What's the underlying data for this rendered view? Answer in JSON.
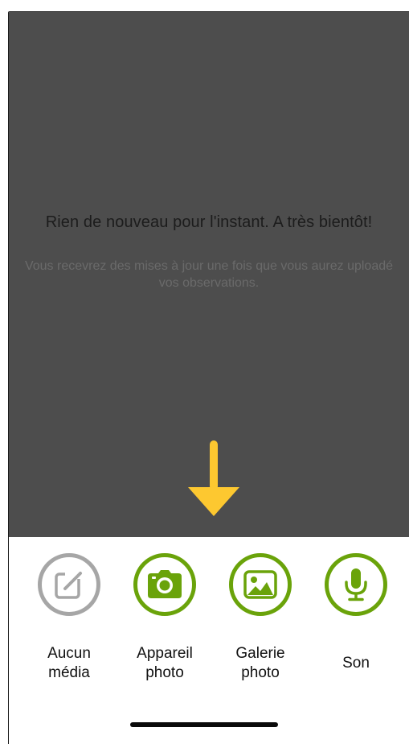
{
  "empty_state": {
    "title": "Rien de nouveau pour l'instant. A très bientôt!",
    "subtitle": "Vous recevrez des mises à jour une fois que vous aurez uploadé vos observations."
  },
  "media_options": [
    {
      "label": "Aucun\nmédia",
      "icon": "edit-note-icon",
      "color": "#a6a6a6"
    },
    {
      "label": "Appareil\nphoto",
      "icon": "camera-icon",
      "color": "#6aa30a"
    },
    {
      "label": "Galerie\nphoto",
      "icon": "gallery-image-icon",
      "color": "#6aa30a"
    },
    {
      "label": "Son",
      "icon": "microphone-icon",
      "color": "#6aa30a"
    }
  ],
  "colors": {
    "overlay": "#4d4d4d",
    "arrow": "#fdc830",
    "accent_green": "#6aa30a",
    "disabled_gray": "#a6a6a6"
  }
}
